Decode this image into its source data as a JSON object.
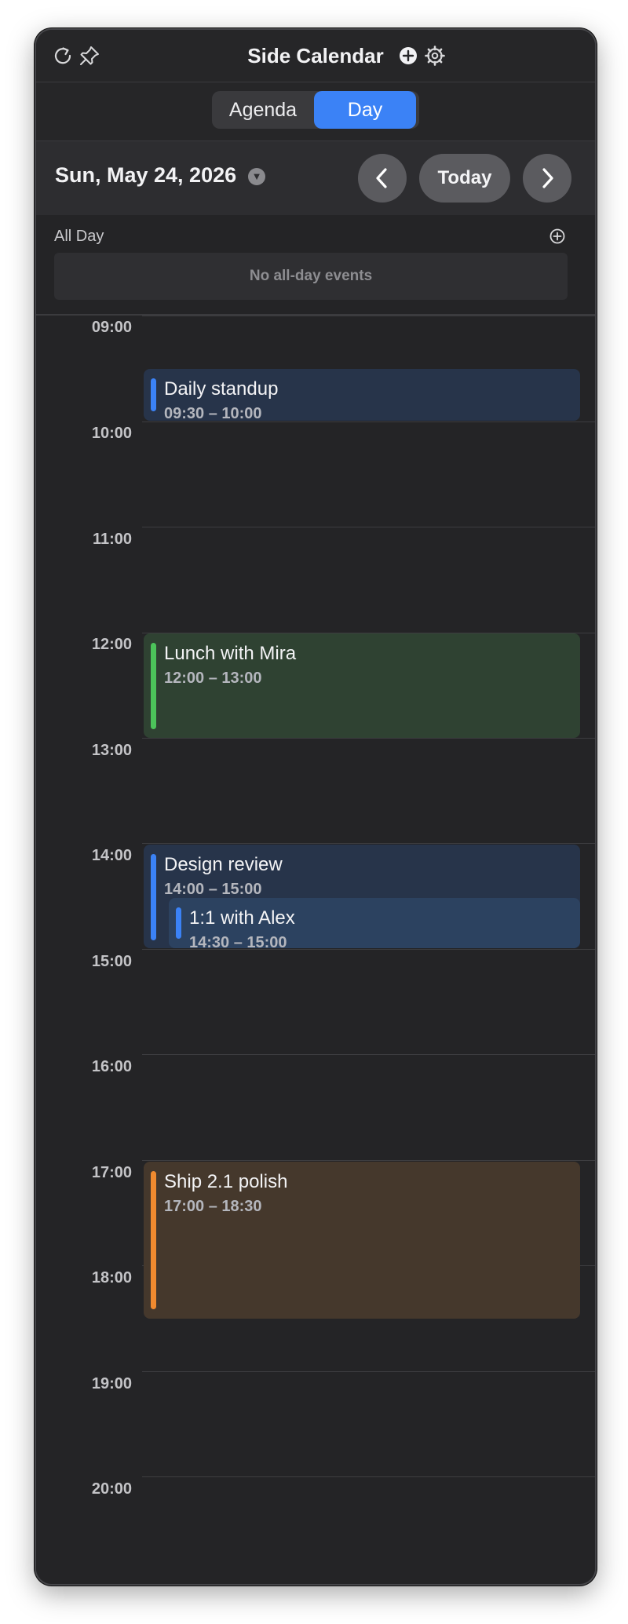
{
  "app": {
    "title": "Side Calendar"
  },
  "toolbar": {
    "left_icons": [
      "refresh-icon",
      "pin-icon"
    ],
    "right_icons": [
      "add-circle-icon",
      "gear-icon"
    ]
  },
  "view_switch": {
    "options": [
      "Agenda",
      "Day"
    ],
    "selected": "Day"
  },
  "date_nav": {
    "current_date": "Sun, May 24, 2026",
    "today_label": "Today",
    "prev_icon": "chevron-left-icon",
    "next_icon": "chevron-right-icon"
  },
  "all_day": {
    "label": "All Day",
    "empty_text": "No all-day events"
  },
  "hours": [
    "09:00",
    "10:00",
    "11:00",
    "12:00",
    "13:00",
    "14:00",
    "15:00",
    "16:00",
    "17:00",
    "18:00",
    "19:00",
    "20:00"
  ],
  "events": [
    {
      "title": "Daily standup",
      "time": "09:30 – 10:00",
      "color": "#3b82f6",
      "bg": "#27344a"
    },
    {
      "title": "Lunch with Mira",
      "time": "12:00 – 13:00",
      "color": "#4cc35a",
      "bg": "#2f4232"
    },
    {
      "title": "Design review",
      "time": "14:00 – 15:00",
      "color": "#3b82f6",
      "bg": "#27344a"
    },
    {
      "title": "1:1 with Alex",
      "time": "14:30 – 15:00",
      "color": "#3b82f6",
      "bg": "#2c4260"
    },
    {
      "title": "Ship 2.1 polish",
      "time": "17:00 – 18:30",
      "color": "#f08a2f",
      "bg": "#45382c"
    }
  ],
  "colors": {
    "accent": "#3b82f6",
    "window_bg": "#242426"
  }
}
